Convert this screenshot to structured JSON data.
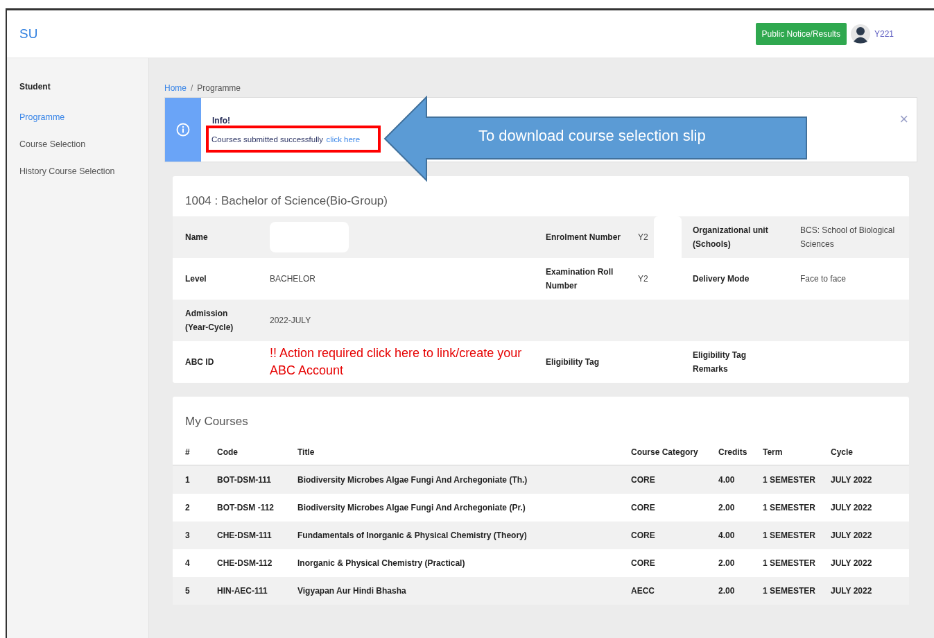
{
  "header": {
    "logo": "SU",
    "notice_button": "Public Notice/Results",
    "user": "Y221"
  },
  "sidebar": {
    "heading": "Student",
    "items": [
      {
        "label": "Programme",
        "selected": true
      },
      {
        "label": "Course Selection",
        "selected": false
      },
      {
        "label": "History Course Selection",
        "selected": false
      }
    ]
  },
  "breadcrumb": {
    "separator": "/",
    "items": [
      {
        "label": "Home",
        "selected": false
      },
      {
        "label": "Programme",
        "selected": true
      }
    ]
  },
  "alert": {
    "title": "Info!",
    "message": "Courses submitted successfully",
    "link": "click here",
    "close": "×",
    "highlighted": true
  },
  "annotation": {
    "text": "To download course selection slip"
  },
  "programme": {
    "title": "1004 : Bachelor of Science(Bio-Group)",
    "rows": [
      {
        "cells": [
          {
            "kind": "label",
            "text": "Name"
          },
          {
            "kind": "redacted"
          },
          {
            "kind": "label",
            "text": "Enrolment Number"
          },
          {
            "kind": "value",
            "text": "Y2",
            "redacted": true
          },
          {
            "kind": "label",
            "text": "Organizational unit (Schools)"
          },
          {
            "kind": "value",
            "text": "BCS: School of Biological Sciences"
          }
        ]
      },
      {
        "cells": [
          {
            "kind": "label",
            "text": "Level"
          },
          {
            "kind": "value",
            "text": "BACHELOR"
          },
          {
            "kind": "label",
            "text": "Examination Roll Number"
          },
          {
            "kind": "value",
            "text": "Y2"
          },
          {
            "kind": "label",
            "text": "Delivery Mode"
          },
          {
            "kind": "value",
            "text": "Face to face"
          }
        ]
      },
      {
        "cells": [
          {
            "kind": "label",
            "text": "Admission (Year-Cycle)"
          },
          {
            "kind": "value",
            "text": "2022-JULY"
          },
          {
            "kind": "empty"
          },
          {
            "kind": "empty"
          },
          {
            "kind": "empty"
          },
          {
            "kind": "empty"
          }
        ]
      },
      {
        "cells": [
          {
            "kind": "label",
            "text": "ABC ID"
          },
          {
            "kind": "alert",
            "text": "!! Action required click here to link/create your ABC Account"
          },
          {
            "kind": "label",
            "text": "Eligibility Tag"
          },
          {
            "kind": "empty"
          },
          {
            "kind": "label",
            "text": "Eligibility Tag Remarks"
          },
          {
            "kind": "empty"
          }
        ]
      }
    ]
  },
  "courses": {
    "title": "My Courses",
    "columns": [
      "#",
      "Code",
      "Title",
      "Course Category",
      "Credits",
      "Term",
      "Cycle"
    ],
    "rows": [
      [
        "1",
        "BOT-DSM-111",
        "Biodiversity Microbes Algae Fungi And Archegoniate (Th.)",
        "CORE",
        "4.00",
        "1 SEMESTER",
        "JULY 2022"
      ],
      [
        "2",
        "BOT-DSM -112",
        "Biodiversity Microbes Algae Fungi And Archegoniate (Pr.)",
        "CORE",
        "2.00",
        "1 SEMESTER",
        "JULY 2022"
      ],
      [
        "3",
        "CHE-DSM-111",
        "Fundamentals of Inorganic & Physical Chemistry (Theory)",
        "CORE",
        "4.00",
        "1 SEMESTER",
        "JULY 2022"
      ],
      [
        "4",
        "CHE-DSM-112",
        "Inorganic & Physical Chemistry (Practical)",
        "CORE",
        "2.00",
        "1 SEMESTER",
        "JULY 2022"
      ],
      [
        "5",
        "HIN-AEC-111",
        "Vigyapan Aur Hindi Bhasha",
        "AECC",
        "2.00",
        "1 SEMESTER",
        "JULY 2022"
      ]
    ]
  }
}
